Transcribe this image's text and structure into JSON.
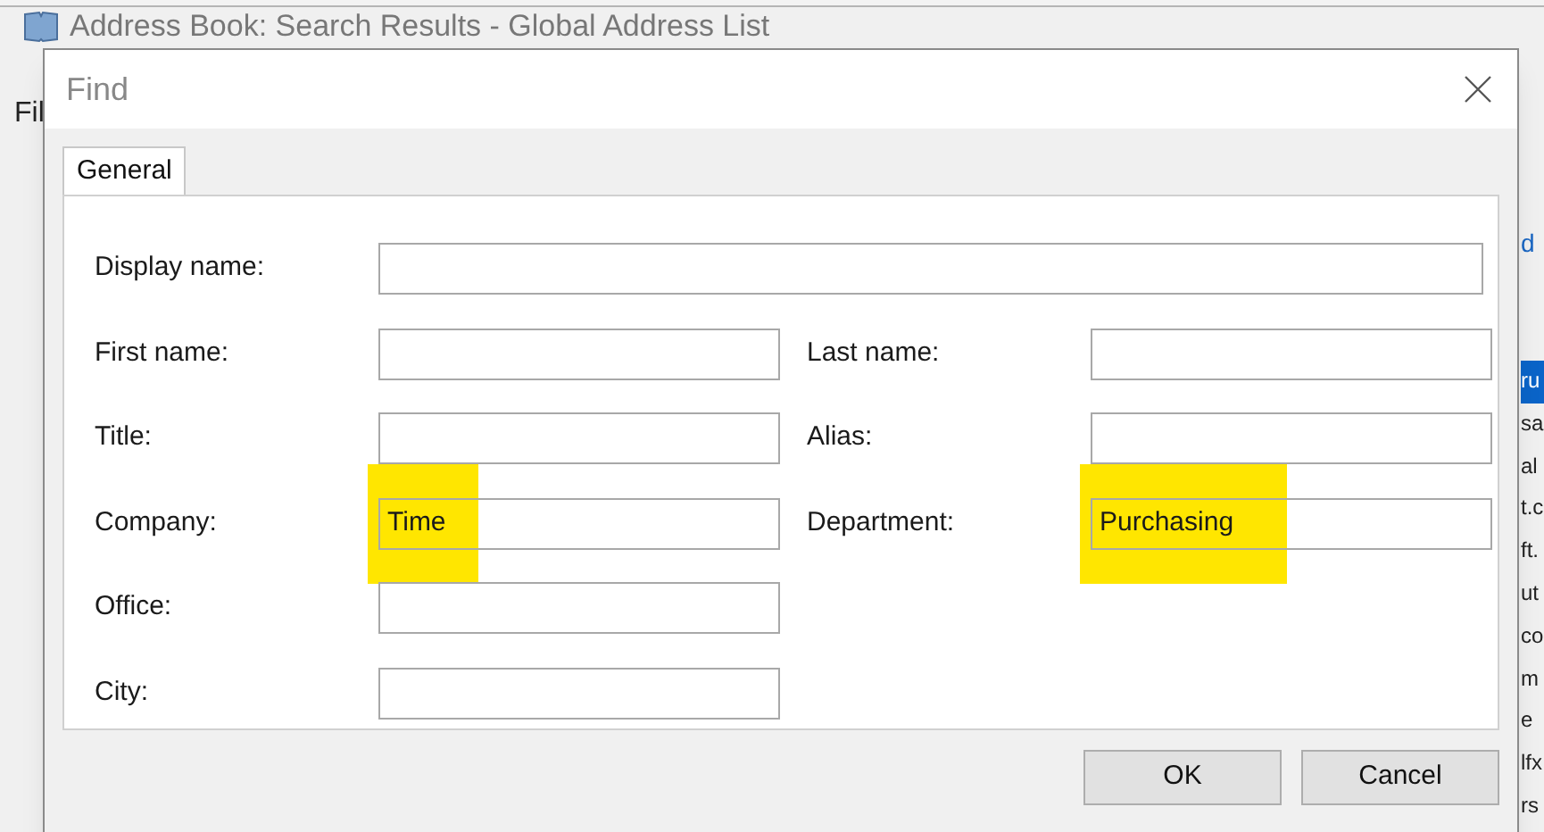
{
  "background_window": {
    "title": "Address Book: Search Results - Global Address List",
    "menu_fragment": "Fil",
    "link_fragment": "d",
    "list_fragments": [
      {
        "text": "ru",
        "selected": true
      },
      {
        "text": "sa",
        "selected": false
      },
      {
        "text": "al",
        "selected": false
      },
      {
        "text": "t.c",
        "selected": false
      },
      {
        "text": "ft.",
        "selected": false
      },
      {
        "text": "ut",
        "selected": false
      },
      {
        "text": "co",
        "selected": false
      },
      {
        "text": "m",
        "selected": false
      },
      {
        "text": "e",
        "selected": false
      },
      {
        "text": "lfx",
        "selected": false
      },
      {
        "text": "rs",
        "selected": false
      }
    ]
  },
  "dialog": {
    "title": "Find",
    "tabs": [
      {
        "label": "General",
        "selected": true
      }
    ],
    "rows": [
      [
        {
          "label": "Display name:",
          "wide": true
        }
      ],
      [
        {
          "label": "First name:"
        },
        {
          "label": "Last name:"
        }
      ],
      [
        {
          "label": "Title:"
        },
        {
          "label": "Alias:"
        }
      ],
      [
        {
          "label": "Company:",
          "value": "Time",
          "highlighted": true
        },
        {
          "label": "Department:",
          "value": "Purchasing",
          "highlighted": true
        }
      ],
      [
        {
          "label": "Office:"
        }
      ],
      [
        {
          "label": "City:"
        }
      ]
    ],
    "buttons": [
      "OK",
      "Cancel"
    ]
  }
}
